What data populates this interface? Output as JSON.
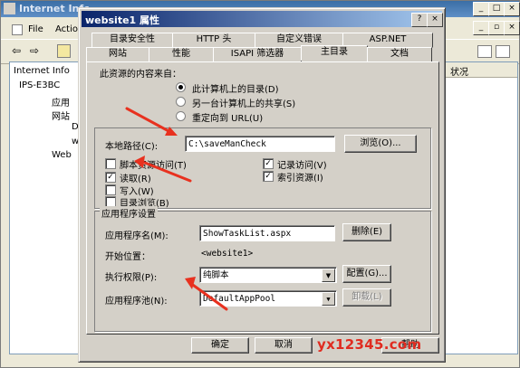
{
  "bg_window": {
    "title": "Internet Infc",
    "menu": [
      "File",
      "Action"
    ],
    "tree": [
      "Internet Info",
      "IPS-E3BC",
      "应用",
      "网站",
      "D",
      "w",
      "Web"
    ],
    "right_header": "状况"
  },
  "dialog": {
    "title": "website1 属性",
    "help_btn": "?",
    "close_btn": "×",
    "tabs_row1": [
      "目录安全性",
      "HTTP 头",
      "自定义错误",
      "ASP.NET"
    ],
    "tabs_row2": [
      "网站",
      "性能",
      "ISAPI 筛选器",
      "主目录",
      "文档"
    ],
    "content_source_label": "此资源的内容来自：",
    "radio_options": [
      "此计算机上的目录(D)",
      "另一台计算机上的共享(S)",
      "重定向到 URL(U)"
    ],
    "local_path_label": "本地路径(C):",
    "local_path_value": "C:\\saveManCheck",
    "browse_btn": "浏览(O)...",
    "checkboxes_left": [
      {
        "label": "脚本资源访问(T)",
        "checked": false
      },
      {
        "label": "读取(R)",
        "checked": true
      },
      {
        "label": "写入(W)",
        "checked": false
      },
      {
        "label": "目录浏览(B)",
        "checked": false
      }
    ],
    "checkboxes_right": [
      {
        "label": "记录访问(V)",
        "checked": true
      },
      {
        "label": "索引资源(I)",
        "checked": true
      }
    ],
    "app_settings_label": "应用程序设置",
    "app_name_label": "应用程序名(M):",
    "app_name_value": "ShowTaskList.aspx",
    "remove_btn": "删除(E)",
    "start_point_label": "开始位置：",
    "start_point_value": "<website1>",
    "exec_perm_label": "执行权限(P):",
    "exec_perm_value": "纯脚本",
    "config_btn": "配置(G)...",
    "app_pool_label": "应用程序池(N):",
    "app_pool_value": "DefaultAppPool",
    "unload_btn": "卸载(L)",
    "ok_btn": "确定",
    "cancel_btn": "取消",
    "help_bottom_btn": "帮助"
  },
  "watermark": "yx12345.com",
  "accent_colors": {
    "annotation_arrow": "#e8311f",
    "title_bar": "#0a246a"
  }
}
